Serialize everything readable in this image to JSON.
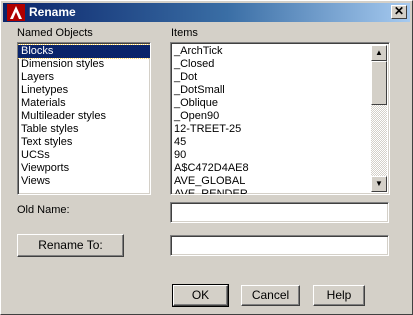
{
  "window": {
    "title": "Rename",
    "close_glyph": "✕",
    "icon": "autocad-app-icon"
  },
  "named_objects": {
    "label": "Named Objects",
    "items": [
      "Blocks",
      "Dimension styles",
      "Layers",
      "Linetypes",
      "Materials",
      "Multileader styles",
      "Table styles",
      "Text styles",
      "UCSs",
      "Viewports",
      "Views"
    ],
    "selected": "Blocks"
  },
  "items_list": {
    "label": "Items",
    "items": [
      "_ArchTick",
      "_Closed",
      "_Dot",
      "_DotSmall",
      "_Oblique",
      "_Open90",
      "12-TREET-25",
      "45",
      "90",
      "A$C472D4AE8",
      "AVE_GLOBAL",
      "AVE_RENDER"
    ]
  },
  "old_name": {
    "label": "Old Name:",
    "value": ""
  },
  "rename_to": {
    "button_label": "Rename To:",
    "value": ""
  },
  "buttons": {
    "ok": "OK",
    "cancel": "Cancel",
    "help": "Help"
  }
}
